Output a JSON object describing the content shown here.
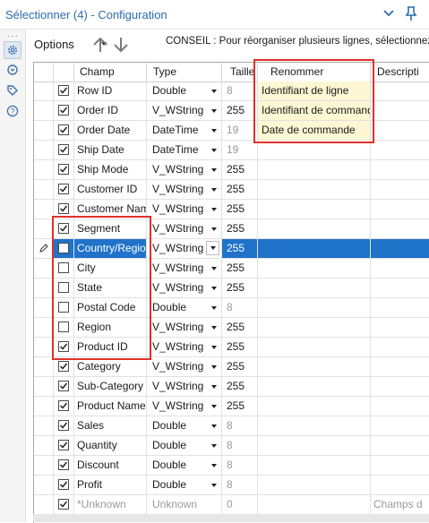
{
  "window": {
    "title": "Sélectionner (4) - Configuration"
  },
  "toolbar": {
    "options_label": "Options",
    "hint": "CONSEIL : Pour réorganiser plusieurs lignes, sélectionnez-"
  },
  "sidebar": {
    "dots": "···"
  },
  "columns": {
    "champ": "Champ",
    "type": "Type",
    "size": "Taille",
    "rename": "Renommer",
    "desc": "Descripti"
  },
  "rows": [
    {
      "checked": true,
      "name": "Row ID",
      "type": "Double",
      "size": "8",
      "size_grey": true,
      "rename": "Identifiant de ligne",
      "desc": ""
    },
    {
      "checked": true,
      "name": "Order ID",
      "type": "V_WString",
      "size": "255",
      "size_grey": false,
      "rename": "Identifiant de commande",
      "desc": ""
    },
    {
      "checked": true,
      "name": "Order Date",
      "type": "DateTime",
      "size": "19",
      "size_grey": true,
      "rename": "Date de commande",
      "desc": ""
    },
    {
      "checked": true,
      "name": "Ship Date",
      "type": "DateTime",
      "size": "19",
      "size_grey": true,
      "rename": "",
      "desc": ""
    },
    {
      "checked": true,
      "name": "Ship Mode",
      "type": "V_WString",
      "size": "255",
      "size_grey": false,
      "rename": "",
      "desc": ""
    },
    {
      "checked": true,
      "name": "Customer ID",
      "type": "V_WString",
      "size": "255",
      "size_grey": false,
      "rename": "",
      "desc": ""
    },
    {
      "checked": true,
      "name": "Customer Name",
      "type": "V_WString",
      "size": "255",
      "size_grey": false,
      "rename": "",
      "desc": ""
    },
    {
      "checked": true,
      "name": "Segment",
      "type": "V_WString",
      "size": "255",
      "size_grey": false,
      "rename": "",
      "desc": ""
    },
    {
      "checked": false,
      "name": "Country/Region",
      "type": "V_WString",
      "size": "255",
      "size_grey": false,
      "rename": "",
      "desc": "",
      "selected": true
    },
    {
      "checked": false,
      "name": "City",
      "type": "V_WString",
      "size": "255",
      "size_grey": false,
      "rename": "",
      "desc": ""
    },
    {
      "checked": false,
      "name": "State",
      "type": "V_WString",
      "size": "255",
      "size_grey": false,
      "rename": "",
      "desc": ""
    },
    {
      "checked": false,
      "name": "Postal Code",
      "type": "Double",
      "size": "8",
      "size_grey": true,
      "rename": "",
      "desc": ""
    },
    {
      "checked": false,
      "name": "Region",
      "type": "V_WString",
      "size": "255",
      "size_grey": false,
      "rename": "",
      "desc": ""
    },
    {
      "checked": true,
      "name": "Product ID",
      "type": "V_WString",
      "size": "255",
      "size_grey": false,
      "rename": "",
      "desc": ""
    },
    {
      "checked": true,
      "name": "Category",
      "type": "V_WString",
      "size": "255",
      "size_grey": false,
      "rename": "",
      "desc": ""
    },
    {
      "checked": true,
      "name": "Sub-Category",
      "type": "V_WString",
      "size": "255",
      "size_grey": false,
      "rename": "",
      "desc": ""
    },
    {
      "checked": true,
      "name": "Product Name",
      "type": "V_WString",
      "size": "255",
      "size_grey": false,
      "rename": "",
      "desc": ""
    },
    {
      "checked": true,
      "name": "Sales",
      "type": "Double",
      "size": "8",
      "size_grey": true,
      "rename": "",
      "desc": ""
    },
    {
      "checked": true,
      "name": "Quantity",
      "type": "Double",
      "size": "8",
      "size_grey": true,
      "rename": "",
      "desc": ""
    },
    {
      "checked": true,
      "name": "Discount",
      "type": "Double",
      "size": "8",
      "size_grey": true,
      "rename": "",
      "desc": ""
    },
    {
      "checked": true,
      "name": "Profit",
      "type": "Double",
      "size": "8",
      "size_grey": true,
      "rename": "",
      "desc": ""
    },
    {
      "checked": true,
      "name": "*Unknown",
      "type": "Unknown",
      "size": "0",
      "size_grey": true,
      "rename": "",
      "desc": "Champs d",
      "unknown": true
    }
  ],
  "colors": {
    "accent": "#2b6cb0",
    "selected_row": "#1f73c8",
    "highlight_box": "#e2302a",
    "rename_fill": "#fdf8d3"
  }
}
